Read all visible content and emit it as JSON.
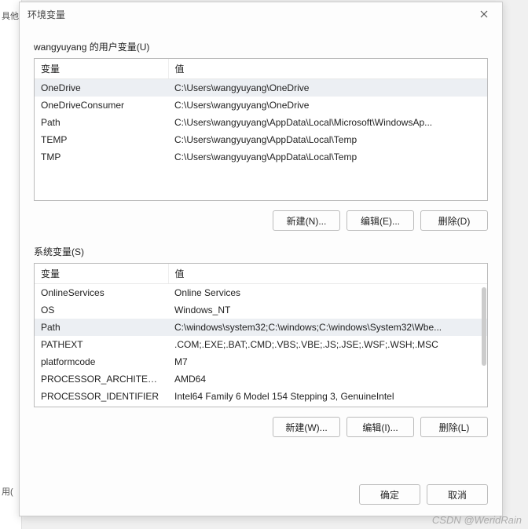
{
  "bg": {
    "top_label": "具他",
    "bottom_label": "用("
  },
  "dialog": {
    "title": "环境变量",
    "user_section": {
      "label": "wangyuyang 的用户变量(U)",
      "headers": {
        "name": "变量",
        "value": "值"
      },
      "rows": [
        {
          "name": "OneDrive",
          "value": "C:\\Users\\wangyuyang\\OneDrive",
          "selected": true
        },
        {
          "name": "OneDriveConsumer",
          "value": "C:\\Users\\wangyuyang\\OneDrive",
          "selected": false
        },
        {
          "name": "Path",
          "value": "C:\\Users\\wangyuyang\\AppData\\Local\\Microsoft\\WindowsAp...",
          "selected": false
        },
        {
          "name": "TEMP",
          "value": "C:\\Users\\wangyuyang\\AppData\\Local\\Temp",
          "selected": false
        },
        {
          "name": "TMP",
          "value": "C:\\Users\\wangyuyang\\AppData\\Local\\Temp",
          "selected": false
        }
      ],
      "buttons": {
        "new": "新建(N)...",
        "edit": "编辑(E)...",
        "delete": "删除(D)"
      }
    },
    "system_section": {
      "label": "系统变量(S)",
      "headers": {
        "name": "变量",
        "value": "值"
      },
      "rows": [
        {
          "name": "OnlineServices",
          "value": "Online Services",
          "selected": false
        },
        {
          "name": "OS",
          "value": "Windows_NT",
          "selected": false
        },
        {
          "name": "Path",
          "value": "C:\\windows\\system32;C:\\windows;C:\\windows\\System32\\Wbe...",
          "selected": true
        },
        {
          "name": "PATHEXT",
          "value": ".COM;.EXE;.BAT;.CMD;.VBS;.VBE;.JS;.JSE;.WSF;.WSH;.MSC",
          "selected": false
        },
        {
          "name": "platformcode",
          "value": "M7",
          "selected": false
        },
        {
          "name": "PROCESSOR_ARCHITECT...",
          "value": "AMD64",
          "selected": false
        },
        {
          "name": "PROCESSOR_IDENTIFIER",
          "value": "Intel64 Family 6 Model 154 Stepping 3, GenuineIntel",
          "selected": false
        }
      ],
      "buttons": {
        "new": "新建(W)...",
        "edit": "编辑(I)...",
        "delete": "删除(L)"
      }
    },
    "footer": {
      "ok": "确定",
      "cancel": "取消"
    }
  },
  "watermark": "CSDN @WeridRain"
}
